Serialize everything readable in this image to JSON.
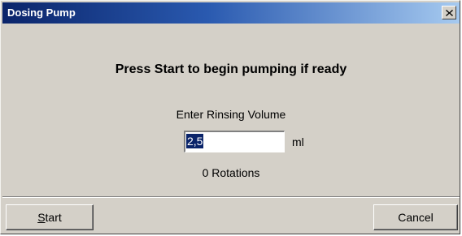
{
  "window": {
    "title": "Dosing Pump",
    "close_icon": "close-icon"
  },
  "dialog": {
    "prompt": "Press Start to begin pumping if ready",
    "rinse_label": "Enter Rinsing Volume",
    "volume_value": "2,5",
    "volume_unit": "ml",
    "rotations_text": "0 Rotations"
  },
  "buttons": {
    "start_accel": "S",
    "start_rest": "tart",
    "cancel_label": "Cancel"
  },
  "colors": {
    "titlebar_start": "#0a246a",
    "titlebar_end": "#a6caf0",
    "face": "#d4d0c8",
    "selection": "#0a246a"
  }
}
